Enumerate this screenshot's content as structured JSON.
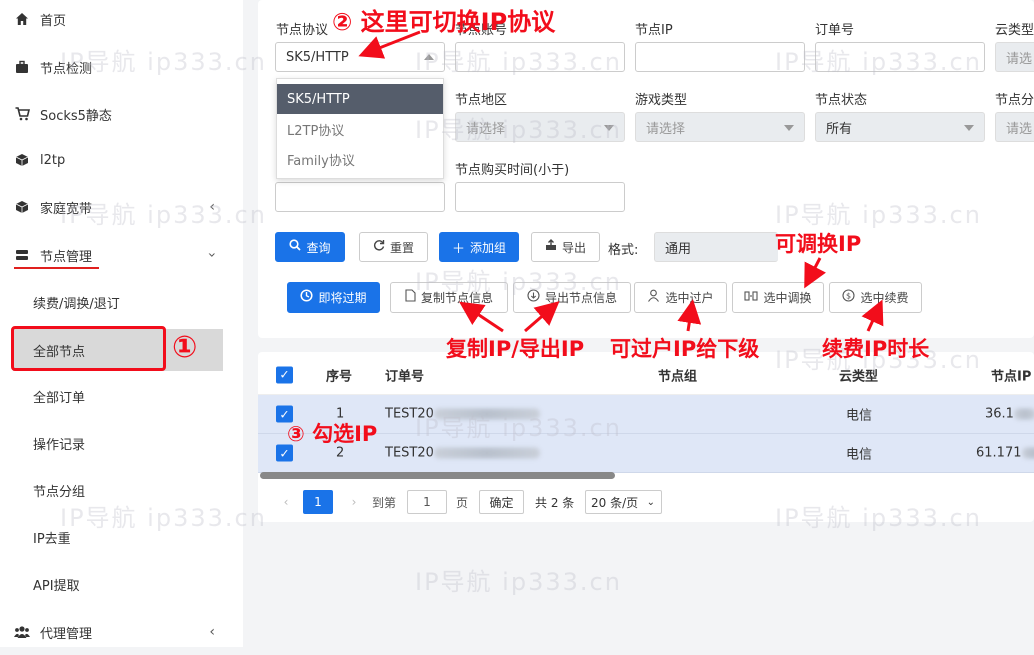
{
  "sidebar": {
    "items": [
      {
        "label": "首页",
        "icon": "home-icon"
      },
      {
        "label": "节点检测",
        "icon": "briefcase-icon"
      },
      {
        "label": "Socks5静态",
        "icon": "cart-icon"
      },
      {
        "label": "l2tp",
        "icon": "cube-icon"
      },
      {
        "label": "家庭宽带",
        "icon": "cube-icon"
      },
      {
        "label": "节点管理",
        "icon": "server-icon"
      }
    ],
    "sub_items": [
      "续费/调换/退订",
      "全部节点",
      "全部订单",
      "操作记录",
      "节点分组",
      "IP去重",
      "API提取"
    ],
    "last_item": {
      "label": "代理管理",
      "icon": "users-icon"
    }
  },
  "filters": {
    "protocol_label": "节点协议",
    "protocol_value": "SK5/HTTP",
    "protocol_options": [
      "SK5/HTTP",
      "L2TP协议",
      "Family协议"
    ],
    "account_label": "节点账号",
    "ip_label": "节点IP",
    "order_label": "订单号",
    "cloud_label": "云类型",
    "cloud_placeholder": "请选",
    "region_label": "节点地区",
    "region_placeholder": "请选择",
    "game_label": "游戏类型",
    "game_placeholder": "请选择",
    "status_label": "节点状态",
    "status_value": "所有",
    "group_label": "节点分",
    "group_placeholder": "请选",
    "buytime_label": "节点购买时间(小于)"
  },
  "buttons": {
    "query": "查询",
    "reset": "重置",
    "add_group": "添加组",
    "export": "导出",
    "format_label": "格式:",
    "format_value": "通用",
    "expiring": "即将过期",
    "copy_info": "复制节点信息",
    "export_info": "导出节点信息",
    "transfer": "选中过户",
    "swap": "选中调换",
    "renew": "选中续费"
  },
  "table": {
    "headers": [
      "序号",
      "订单号",
      "节点组",
      "云类型",
      "节点IP"
    ],
    "rows": [
      {
        "index": "1",
        "order": "TEST20",
        "cloud": "电信",
        "ip": "36.1"
      },
      {
        "index": "2",
        "order": "TEST20",
        "cloud": "电信",
        "ip": "61.171"
      }
    ]
  },
  "pagination": {
    "current": "1",
    "goto_label": "到第",
    "goto_value": "1",
    "page_label": "页",
    "confirm": "确定",
    "total": "共 2 条",
    "page_size": "20 条/页"
  },
  "annotations": {
    "step1": "①",
    "step2": "② 这里可切换IP协议",
    "step3": "③ 勾选IP",
    "swap_note": "可调换IP",
    "copy_export_note": "复制IP/导出IP",
    "transfer_note": "可过户IP给下级",
    "renew_note": "续费IP时长"
  },
  "watermark": "IP导航  ip333.cn",
  "colors": {
    "primary": "#1a73e8",
    "annotation_red": "#f20d1b",
    "row_selected": "#dfe7f7"
  }
}
